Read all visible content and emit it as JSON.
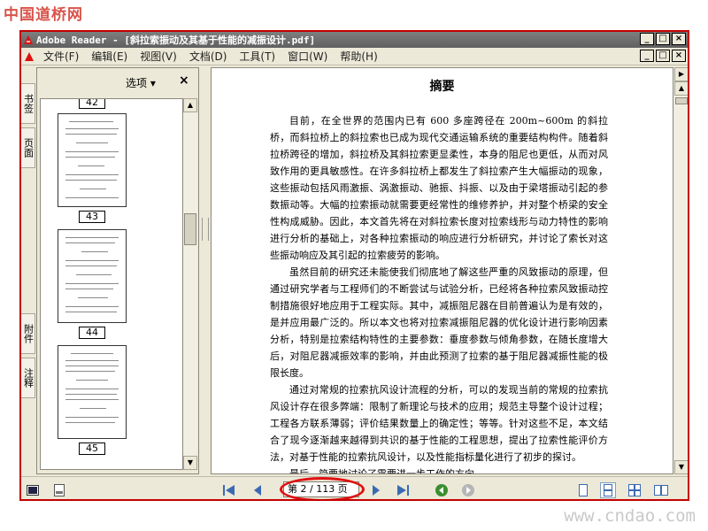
{
  "watermark": {
    "top": "中国道桥网",
    "bottom": "www.cndao.com"
  },
  "window": {
    "title": "Adobe Reader - [斜拉索振动及其基于性能的减振设计.pdf]",
    "controls": [
      "_",
      "□",
      "×"
    ]
  },
  "menu": {
    "items": [
      "文件(F)",
      "编辑(E)",
      "视图(V)",
      "文档(D)",
      "工具(T)",
      "窗口(W)",
      "帮助(H)"
    ]
  },
  "side_tabs": [
    "书签",
    "页面",
    "附件",
    "注释"
  ],
  "side_panel": {
    "options_label": "选项 ▾",
    "close_label": "×",
    "thumbnails": [
      {
        "label": "42"
      },
      {
        "label": "43"
      },
      {
        "label": "44"
      },
      {
        "label": "45"
      }
    ]
  },
  "document": {
    "heading": "摘要",
    "paragraphs": [
      "目前，在全世界的范围内已有 600 多座跨径在 200m~600m 的斜拉桥，而斜拉桥上的斜拉索也已成为现代交通运输系统的重要结构构件。随着斜拉桥跨径的增加，斜拉桥及其斜拉索更显柔性，本身的阻尼也更低，从而对风致作用的更具敏感性。在许多斜拉桥上都发生了斜拉索产生大幅振动的现象，这些振动包括风雨激振、涡激振动、驰振、抖振、以及由于梁塔振动引起的参数振动等。大幅的拉索振动就需要更经常性的维修养护，并对整个桥梁的安全性构成威胁。因此，本文首先将在对斜拉索长度对拉索线形与动力特性的影响进行分析的基础上，对各种拉索振动的响应进行分析研究，并讨论了索长对这些振动响应及其引起的拉索疲劳的影响。",
      "虽然目前的研究还未能使我们彻底地了解这些严重的风致振动的原理，但通过研究学者与工程师们的不断尝试与试验分析，已经将各种拉索风致振动控制措施很好地应用于工程实际。其中，减振阻尼器在目前普遍认为是有效的，是并应用最广泛的。所以本文也将对拉索减振阻尼器的优化设计进行影响因素分析，特别是拉索结构特性的主要参数：垂度参数与倾角参数，在随长度增大后，对阻尼器减振效率的影响，并由此预测了拉索的基于阻尼器减振性能的极限长度。",
      "通过对常规的拉索抗风设计流程的分析，可以的发现当前的常规的拉索抗风设计存在很多弊端：限制了新理论与技术的应用；规范主导整个设计过程；工程各方联系薄弱；评价结果数量上的确定性；等等。针对这些不足，本文结合了现今逐渐越来越得到共识的基于性能的工程思想，提出了拉索性能评价方法，对基于性能的拉索抗风设计，以及性能指标量化进行了初步的探讨。",
      "最后，简要地讨论了需要进一步工作的方向。"
    ]
  },
  "navigation": {
    "page_display": "第 2 / 113 页"
  },
  "colors": {
    "frame_red": "#c40000",
    "annotation_red": "#e01010",
    "chrome": "#ece9d8"
  }
}
